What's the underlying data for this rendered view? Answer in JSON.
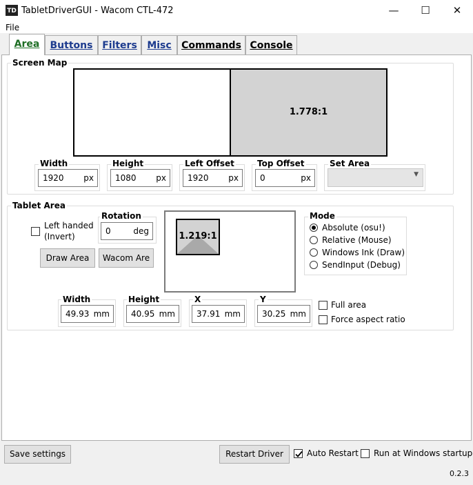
{
  "window": {
    "icon_text": "TD",
    "title": "TabletDriverGUI - Wacom CTL-472",
    "minimize": "—",
    "maximize": "☐",
    "close": "✕"
  },
  "menu": {
    "file": "File"
  },
  "tabs": [
    {
      "label": "Area"
    },
    {
      "label": "Buttons"
    },
    {
      "label": "Filters"
    },
    {
      "label": "Misc"
    },
    {
      "label": "Commands"
    },
    {
      "label": "Console"
    }
  ],
  "screen_map": {
    "title": "Screen Map",
    "ratio": "1.778:1",
    "width": {
      "label": "Width",
      "value": "1920",
      "unit": "px"
    },
    "height": {
      "label": "Height",
      "value": "1080",
      "unit": "px"
    },
    "left_offset": {
      "label": "Left Offset",
      "value": "1920",
      "unit": "px"
    },
    "top_offset": {
      "label": "Top Offset",
      "value": "0",
      "unit": "px"
    },
    "set_area": {
      "label": "Set Area",
      "value": ""
    }
  },
  "tablet_area": {
    "title": "Tablet Area",
    "left_handed": "Left handed\n(Invert)",
    "left_handed_line1": "Left handed",
    "left_handed_line2": "(Invert)",
    "rotation": {
      "label": "Rotation",
      "value": "0",
      "unit": "deg"
    },
    "draw_area": "Draw Area",
    "wacom_area": "Wacom Are",
    "ratio": "1.219:1",
    "mode": {
      "title": "Mode",
      "options": [
        "Absolute (osu!)",
        "Relative (Mouse)",
        "Windows Ink (Draw)",
        "SendInput (Debug)"
      ],
      "selected": "Absolute (osu!)"
    },
    "width": {
      "label": "Width",
      "value": "49.93",
      "unit": "mm"
    },
    "height": {
      "label": "Height",
      "value": "40.95",
      "unit": "mm"
    },
    "x": {
      "label": "X",
      "value": "37.91",
      "unit": "mm"
    },
    "y": {
      "label": "Y",
      "value": "30.25",
      "unit": "mm"
    },
    "full_area": "Full area",
    "force_aspect": "Force aspect ratio"
  },
  "footer": {
    "save_settings": "Save settings",
    "restart_driver": "Restart Driver",
    "auto_restart": "Auto Restart",
    "auto_restart_checked": true,
    "run_at_startup": "Run at Windows startup",
    "run_at_startup_checked": false,
    "version": "0.2.3"
  }
}
